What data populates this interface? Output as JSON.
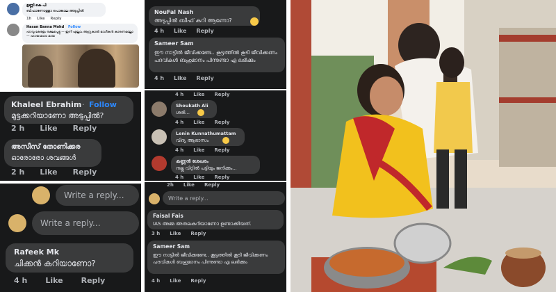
{
  "p1": {
    "c1": {
      "author": "ഉണ്ണി കെ പി",
      "text": "ബിഫാണോള്ളാ പൊങ്കാല അടുപ്പിൽ",
      "time": "1h",
      "like": "Like",
      "reply": "Reply"
    },
    "c2": {
      "author": "Hasan Banna Mohd",
      "follow": "Follow",
      "text": "ഹാവൂ കേരളം രക്ഷപ്പെട്ടു — ഇനി എല്ലാം ആറ്റുകാൽ ഭാഗീകൻ കാരണമല്ലോ — ഹാഷ മഹാ മായ"
    }
  },
  "p2": {
    "c1": {
      "author": "NouFal Nash",
      "text": "അടുപ്പിൽ ബീഫ് കറി ആണോ?",
      "time": "4 h",
      "like": "Like",
      "reply": "Reply"
    },
    "c2": {
      "author": "Sameer Sam",
      "text": "ഈ നാട്ടിൽ ജീവിക്കണ്ടേ.. കൂട്ടത്തിൽ കൂടി ജീവിക്കണം പദവികൾ ബഹുമാനം പിന്നുണ്ടാ എ ലഭിക്കും",
      "time": "4 h",
      "like": "Like",
      "reply": "Reply"
    }
  },
  "p3": {
    "c1": {
      "author": "Khaleel Ebrahim",
      "sep": "·",
      "follow": "Follow",
      "text": "മുട്ടക്കറിയാണോ അടുപ്പിൽ?",
      "time": "2 h",
      "like": "Like",
      "reply": "Reply"
    },
    "c2": {
      "author": "അസീസ് തോണിക്കര",
      "text": "ഓരോരോ ശവങ്ങൾ",
      "time": "2 h",
      "like": "Like",
      "reply": "Reply"
    }
  },
  "p4": {
    "top_meta": {
      "time": "4 h",
      "like": "Like",
      "reply": "Reply"
    },
    "c1": {
      "author": "Shoukath Ali",
      "text": "ശരി...",
      "time": "4 h",
      "like": "Like",
      "reply": "Reply"
    },
    "c2": {
      "author": "Lenin Kunnathumattam",
      "text": "വിദ്യ ആഭാസം",
      "time": "4 h",
      "like": "Like",
      "reply": "Reply"
    },
    "c3": {
      "author": "കണ്ണൻ ശേഖരം",
      "text": "നല്ല വിറ്റിൽ പട്ടിയും ജനിക്കും...",
      "time": "4 h",
      "like": "Like",
      "reply": "Reply"
    }
  },
  "p5": {
    "reply1": "Write a reply...",
    "reply2": "Write a reply...",
    "c1": {
      "author": "Rafeek Mk",
      "text": "ചിക്കൻ കറിയാണോ?",
      "time": "4 h",
      "like": "Like",
      "reply": "Reply"
    }
  },
  "p6": {
    "top_meta": {
      "time": "2h",
      "like": "Like",
      "reply": "Reply"
    },
    "reply1": "Write a reply...",
    "c1": {
      "author": "Faisal Fais",
      "text": "IAS അമ്മ അതലകറിയാണോ ഉണ്ടാക്കിയത്.",
      "time": "3 h",
      "like": "Like",
      "reply": "Reply"
    },
    "c2": {
      "author": "Sameer Sam",
      "text": "ഈ നാട്ടിൽ ജീവിക്കണ്ടേ.. കൂട്ടത്തിൽ കൂടി ജീവിക്കണം പദവികൾ ബഹുമാനം പിന്നുണ്ടാ എ ലഭിക്കും",
      "time": "4 h",
      "like": "Like",
      "reply": "Reply"
    }
  },
  "colors": {
    "panel_bg": "#18191a",
    "bubble_bg": "#3a3b3c",
    "text": "#e4e6eb",
    "meta": "#b0b3b8",
    "follow": "#2d88ff"
  }
}
